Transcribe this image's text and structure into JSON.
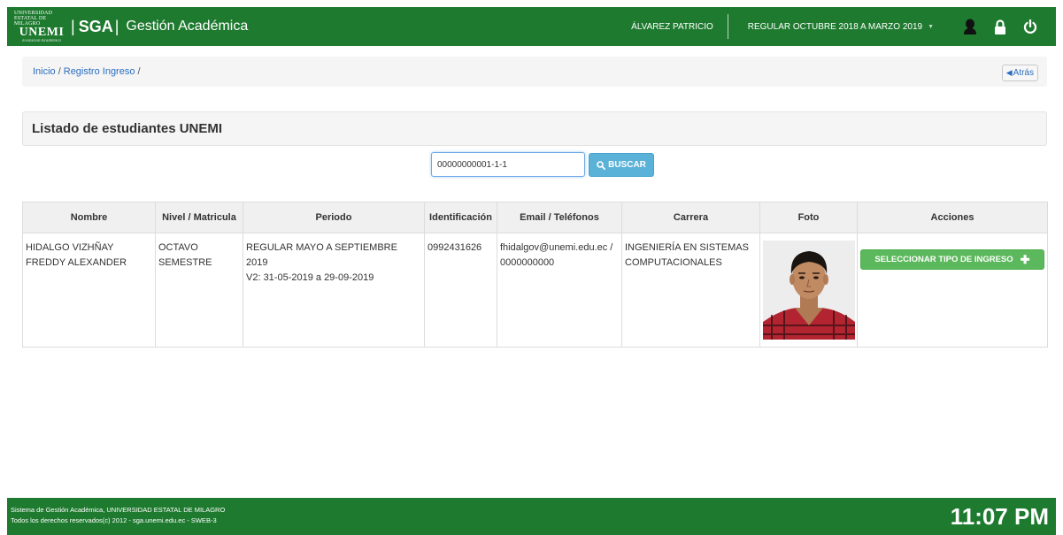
{
  "header": {
    "logo_line1": "UNIVERSIDAD ESTATAL DE MILAGRO",
    "logo_line2": "UNEMI",
    "logo_line3": "Evolución Académica",
    "separator": "|",
    "app_name": "SGA",
    "app_subtitle": "Gestión Académica",
    "user_name": "ÁLVAREZ PATRICIO",
    "period": "REGULAR OCTUBRE 2018 A MARZO 2019",
    "bg_color": "#1e7a2f",
    "icons": [
      "user-icon",
      "lock-icon",
      "power-icon"
    ]
  },
  "breadcrumb": {
    "items": [
      "Inicio",
      "Registro Ingreso"
    ],
    "separator": "/",
    "back_label": "Atrás"
  },
  "panel": {
    "title": "Listado de estudiantes UNEMI"
  },
  "search": {
    "value": "00000000001-1-1",
    "button_label": "BUSCAR"
  },
  "table": {
    "headers": [
      "Nombre",
      "Nivel / Matricula",
      "Periodo",
      "Identificación",
      "Email / Teléfonos",
      "Carrera",
      "Foto",
      "Acciones"
    ],
    "rows": [
      {
        "nombre": "HIDALGO VIZHÑAY FREDDY ALEXANDER",
        "nivel": "OCTAVO SEMESTRE",
        "periodo_line1": "REGULAR MAYO A SEPTIEMBRE 2019",
        "periodo_line2": "V2: 31-05-2019 a 29-09-2019",
        "identificacion": "0992431626",
        "email": "fhidalgov@unemi.edu.ec /",
        "telefono": "0000000000",
        "carrera": "INGENIERÍA EN SISTEMAS COMPUTACIONALES",
        "action_label": "SELECCIONAR TIPO DE INGRESO"
      }
    ]
  },
  "footer": {
    "line1": "Sistema de Gestión Académica, UNIVERSIDAD ESTATAL DE MILAGRO",
    "line2": "Todos los derechos reservados(c) 2012 - sga.unemi.edu.ec - SWEB-3",
    "clock": "11:07 PM"
  },
  "colors": {
    "primary_green": "#1e7a2f",
    "link_blue": "#2a6dc0",
    "info_button": "#5bb2d8",
    "success_button": "#5cb85c"
  }
}
